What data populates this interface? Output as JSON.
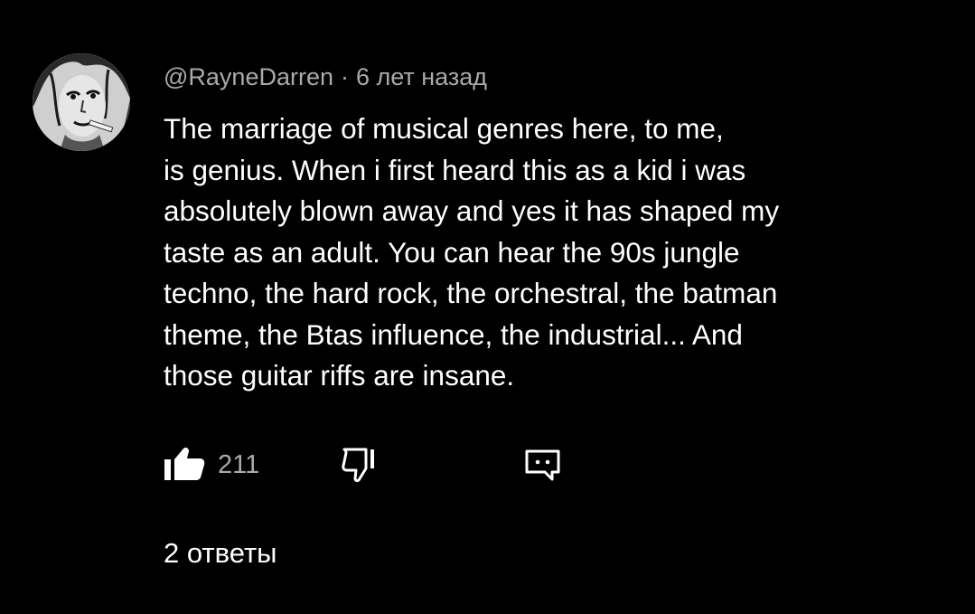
{
  "comment": {
    "author": "@RayneDarren",
    "separator": "·",
    "time": "6 лет назад",
    "text_lines": [
      "The marriage of musical genres here, to me,",
      "is genius. When i first heard this as a kid i was",
      "absolutely blown away and yes it has shaped my",
      "taste as an adult. You can hear the 90s jungle",
      "techno, the hard rock, the orchestral, the batman",
      "theme, the Btas influence, the industrial... And",
      "those guitar riffs are insane."
    ]
  },
  "actions": {
    "like_icon": "thumbs-up-filled-icon",
    "like_count": "211",
    "dislike_icon": "thumbs-down-icon",
    "reply_icon": "comment-reply-icon"
  },
  "replies_label": "2 ответы",
  "colors": {
    "background": "#000000",
    "primary_text": "#ffffff",
    "secondary_text": "#aaaaaa"
  }
}
